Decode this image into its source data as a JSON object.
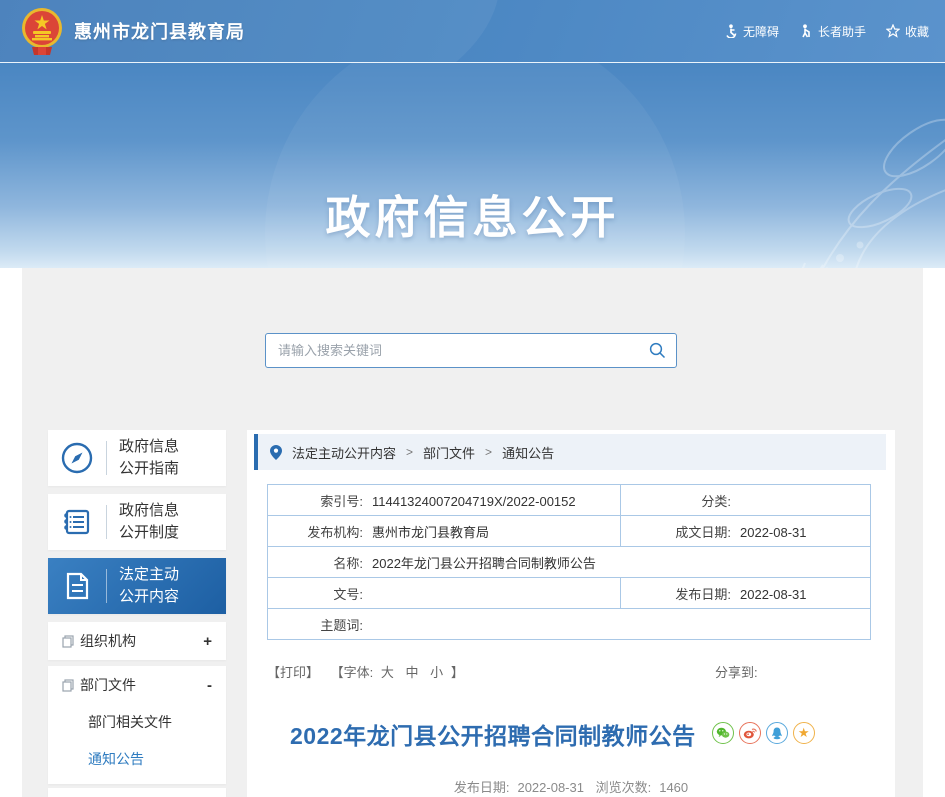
{
  "header": {
    "site_title": "惠州市龙门县教育局",
    "links": [
      {
        "label": "无障碍",
        "icon": "accessibility-icon"
      },
      {
        "label": "长者助手",
        "icon": "elder-assist-icon"
      },
      {
        "label": "收藏",
        "icon": "star-icon"
      }
    ]
  },
  "banner": {
    "title": "政府信息公开"
  },
  "search": {
    "placeholder": "请输入搜索关键词"
  },
  "sidebar": {
    "items": [
      {
        "line1": "政府信息",
        "line2": "公开指南",
        "icon": "compass-icon",
        "active": false
      },
      {
        "line1": "政府信息",
        "line2": "公开制度",
        "icon": "book-icon",
        "active": false
      },
      {
        "line1": "法定主动",
        "line2": "公开内容",
        "icon": "document-icon",
        "active": true
      }
    ],
    "submenu": [
      {
        "label": "组织机构",
        "toggle": "+"
      },
      {
        "label": "部门文件",
        "toggle": "-",
        "children": [
          {
            "label": "部门相关文件",
            "active": false
          },
          {
            "label": "通知公告",
            "active": true
          }
        ]
      }
    ]
  },
  "breadcrumb": {
    "separator": ">",
    "items": [
      "法定主动公开内容",
      "部门文件",
      "通知公告"
    ]
  },
  "meta_table": {
    "index_label": "索引号:",
    "index_value": "11441324007204719X/2022-00152",
    "category_label": "分类:",
    "category_value": "",
    "publisher_label": "发布机构:",
    "publisher_value": "惠州市龙门县教育局",
    "write_date_label": "成文日期:",
    "write_date_value": "2022-08-31",
    "name_label": "名称:",
    "name_value": "2022年龙门县公开招聘合同制教师公告",
    "doc_no_label": "文号:",
    "doc_no_value": "",
    "publish_date_label": "发布日期:",
    "publish_date_value": "2022-08-31",
    "keywords_label": "主题词:",
    "keywords_value": ""
  },
  "toolbar": {
    "print": "【打印】",
    "font_prefix": "【字体:",
    "sizes": [
      "大",
      "中",
      "小"
    ],
    "font_suffix": "】",
    "share_label": "分享到:"
  },
  "article": {
    "title": "2022年龙门县公开招聘合同制教师公告",
    "publish_date_label": "发布日期:",
    "publish_date": "2022-08-31",
    "views_label": "浏览次数:",
    "views": "1460"
  },
  "share_icons": [
    "wechat-icon",
    "weibo-icon",
    "qq-icon",
    "favorite-star-icon"
  ],
  "colors": {
    "header_blue": "#4a86c2",
    "accent_blue": "#2a6cb0",
    "link_blue": "#2f7cc0",
    "title_blue": "#2e6cb0",
    "table_border": "#aac8e6",
    "wechat_green": "#52b72e",
    "weibo_orange": "#e0563c",
    "qq_blue": "#3f9fd8",
    "star_yellow": "#f0a832"
  }
}
